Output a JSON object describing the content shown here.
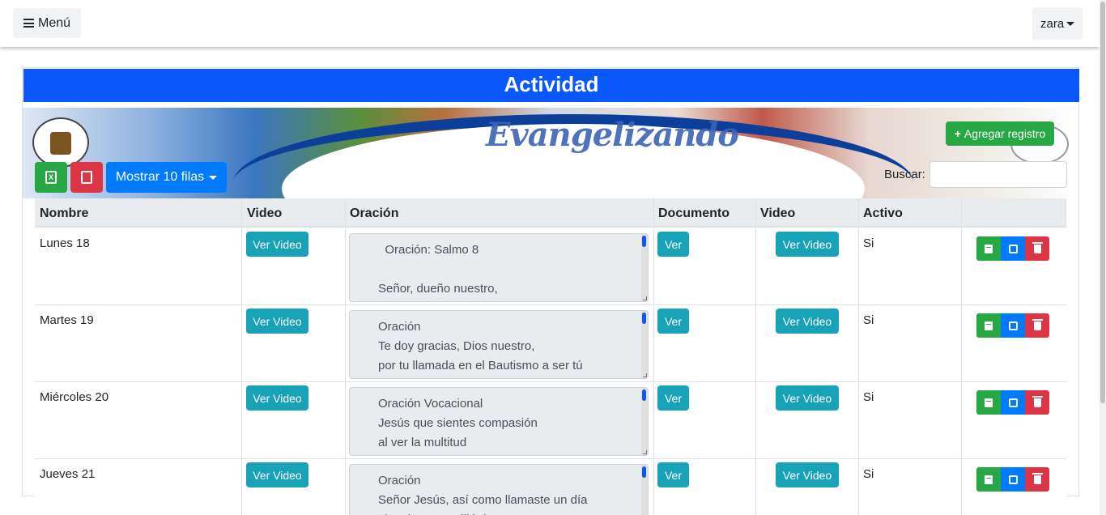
{
  "navbar": {
    "menu_label": "Menú",
    "user_label": "zara"
  },
  "card": {
    "title": "Actividad"
  },
  "banner": {
    "brand_text": "Evangelizando"
  },
  "toolbar": {
    "excel_icon": "file-excel-icon",
    "pdf_icon": "file-pdf-icon",
    "rows_label": "Mostrar 10 filas",
    "add_label": "Agregar registro",
    "search_label": "Buscar:",
    "search_value": ""
  },
  "table": {
    "headers": [
      "Nombre",
      "Video",
      "Oración",
      "Documento",
      "Video",
      "Activo",
      ""
    ],
    "rows": [
      {
        "nombre": "Lunes 18",
        "video_btn": "Ver Video",
        "oracion": "  Oración: Salmo 8\n\nSeñor, dueño nuestro,",
        "doc_btn": "Ver",
        "video2_btn": "Ver Video",
        "activo": "Si"
      },
      {
        "nombre": "Martes 19",
        "video_btn": "Ver Video",
        "oracion": "Oración\nTe doy gracias, Dios nuestro,\npor tu llamada en el Bautismo a ser tú",
        "doc_btn": "Ver",
        "video2_btn": "Ver Video",
        "activo": "Si"
      },
      {
        "nombre": "Miércoles 20",
        "video_btn": "Ver Video",
        "oracion": "Oración Vocacional\nJesús que sientes compasión\nal ver la multitud",
        "doc_btn": "Ver",
        "video2_btn": "Ver Video",
        "activo": "Si"
      },
      {
        "nombre": "Jueves 21",
        "video_btn": "Ver Video",
        "oracion": "Oración\nSeñor Jesús, así como llamaste un día\nalgunios a me dijé dos",
        "doc_btn": "Ver",
        "video2_btn": "Ver Video",
        "activo": "Si"
      }
    ]
  },
  "colors": {
    "primary": "#0a58fc",
    "success": "#28a745",
    "danger": "#dc3545",
    "info": "#17a2b8"
  }
}
